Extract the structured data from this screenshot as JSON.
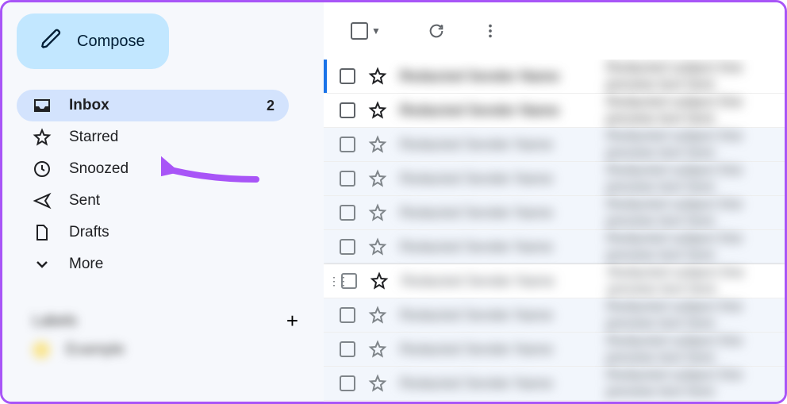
{
  "compose": {
    "label": "Compose"
  },
  "sidebar": {
    "items": [
      {
        "label": "Inbox",
        "count": "2"
      },
      {
        "label": "Starred"
      },
      {
        "label": "Snoozed"
      },
      {
        "label": "Sent"
      },
      {
        "label": "Drafts"
      },
      {
        "label": "More"
      }
    ],
    "labels_heading": "Labels",
    "label_example": "Example"
  },
  "annotation": {
    "target": "Snoozed",
    "color": "#a855f7"
  },
  "rows": [
    {
      "unread": true,
      "first": true
    },
    {
      "unread": true
    },
    {
      "unread": false
    },
    {
      "unread": false
    },
    {
      "unread": false
    },
    {
      "unread": false
    },
    {
      "unread": false,
      "hover": true
    },
    {
      "unread": false
    },
    {
      "unread": false
    },
    {
      "unread": false
    }
  ]
}
